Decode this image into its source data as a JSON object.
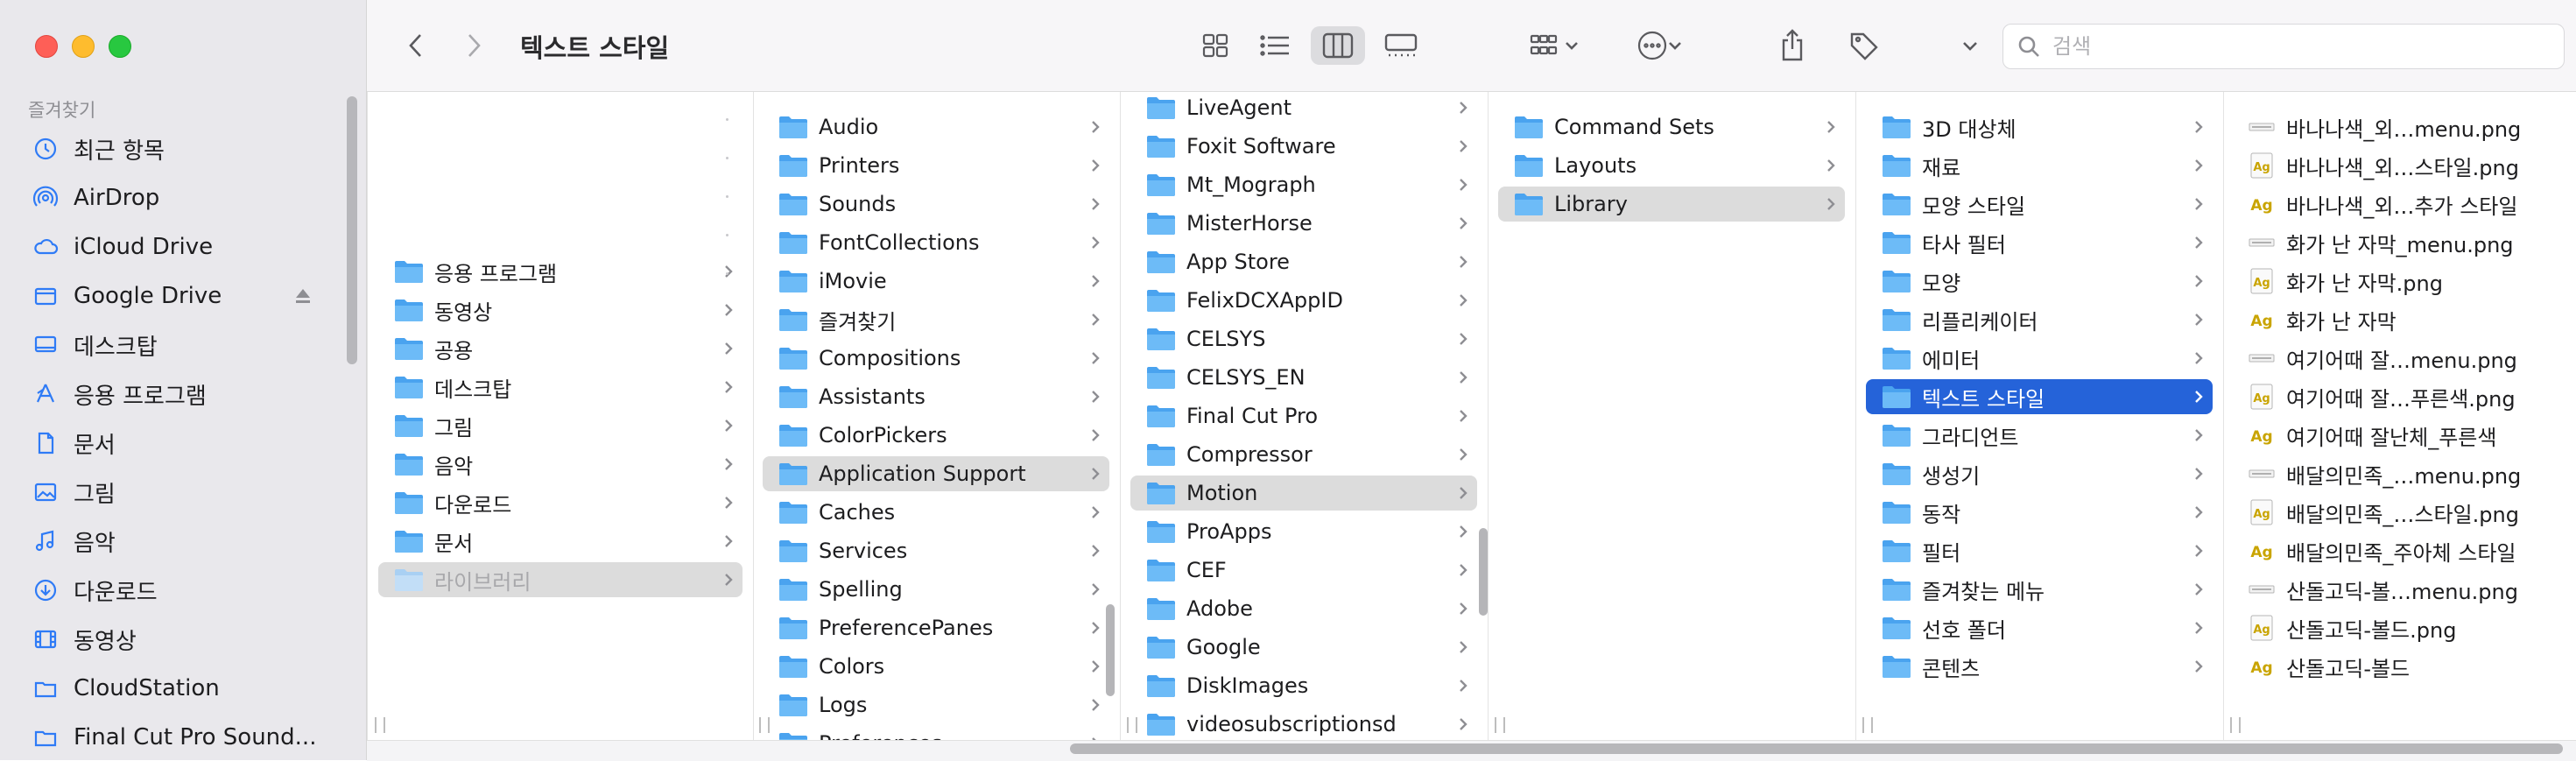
{
  "window": {
    "title": "텍스트 스타일",
    "traffic_lights": {
      "close": "#fe5f57",
      "minimize": "#febc2e",
      "zoom": "#28c840"
    }
  },
  "sidebar": {
    "heading": "즐겨찾기",
    "accent_color": "#2f7bf6",
    "items": [
      {
        "label": "최근 항목",
        "icon": "clock-icon"
      },
      {
        "label": "AirDrop",
        "icon": "airdrop-icon"
      },
      {
        "label": "iCloud Drive",
        "icon": "cloud-icon"
      },
      {
        "label": "Google Drive",
        "icon": "drive-folder-icon"
      },
      {
        "label": "데스크탑",
        "icon": "desktop-icon"
      },
      {
        "label": "응용 프로그램",
        "icon": "apps-icon"
      },
      {
        "label": "문서",
        "icon": "document-icon"
      },
      {
        "label": "그림",
        "icon": "photo-icon"
      },
      {
        "label": "음악",
        "icon": "music-icon"
      },
      {
        "label": "다운로드",
        "icon": "download-icon"
      },
      {
        "label": "동영상",
        "icon": "film-icon"
      },
      {
        "label": "CloudStation",
        "icon": "folder-icon"
      },
      {
        "label": "Final Cut Pro Sound...",
        "icon": "folder-icon"
      }
    ]
  },
  "toolbar": {
    "back_icon": "chevron-left-icon",
    "forward_icon": "chevron-right-icon",
    "view_modes": [
      "icon-view",
      "list-view",
      "column-view",
      "gallery-view"
    ],
    "active_view": "column-view",
    "search_placeholder": "검색"
  },
  "columns": [
    {
      "id": "home",
      "items": [
        {
          "name": "응용 프로그램",
          "icon": "folder"
        },
        {
          "name": "동영상",
          "icon": "folder"
        },
        {
          "name": "공용",
          "icon": "folder"
        },
        {
          "name": "데스크탑",
          "icon": "folder"
        },
        {
          "name": "그림",
          "icon": "folder"
        },
        {
          "name": "음악",
          "icon": "folder"
        },
        {
          "name": "다운로드",
          "icon": "folder"
        },
        {
          "name": "문서",
          "icon": "folder"
        },
        {
          "name": "라이브러리",
          "icon": "folder",
          "state": "selected-gray-dim"
        }
      ]
    },
    {
      "id": "library",
      "items": [
        {
          "name": "Audio"
        },
        {
          "name": "Printers"
        },
        {
          "name": "Sounds"
        },
        {
          "name": "FontCollections"
        },
        {
          "name": "iMovie"
        },
        {
          "name": "즐겨찾기"
        },
        {
          "name": "Compositions"
        },
        {
          "name": "Assistants"
        },
        {
          "name": "ColorPickers"
        },
        {
          "name": "Application Support",
          "state": "selected-gray"
        },
        {
          "name": "Caches"
        },
        {
          "name": "Services"
        },
        {
          "name": "Spelling"
        },
        {
          "name": "PreferencePanes"
        },
        {
          "name": "Colors"
        },
        {
          "name": "Logs"
        },
        {
          "name": "Preferences"
        }
      ]
    },
    {
      "id": "application-support",
      "items": [
        {
          "name": "LiveAgent"
        },
        {
          "name": "Foxit Software"
        },
        {
          "name": "Mt_Mograph"
        },
        {
          "name": "MisterHorse"
        },
        {
          "name": "App Store"
        },
        {
          "name": "FelixDCXAppID"
        },
        {
          "name": "CELSYS"
        },
        {
          "name": "CELSYS_EN"
        },
        {
          "name": "Final Cut Pro"
        },
        {
          "name": "Compressor"
        },
        {
          "name": "Motion",
          "state": "selected-gray"
        },
        {
          "name": "ProApps"
        },
        {
          "name": "CEF"
        },
        {
          "name": "Adobe"
        },
        {
          "name": "Google"
        },
        {
          "name": "DiskImages"
        },
        {
          "name": "videosubscriptionsd"
        }
      ]
    },
    {
      "id": "motion",
      "items": [
        {
          "name": "Command Sets"
        },
        {
          "name": "Layouts"
        },
        {
          "name": "Library",
          "state": "selected-gray"
        }
      ]
    },
    {
      "id": "motion-library",
      "items": [
        {
          "name": "3D 대상체"
        },
        {
          "name": "재료"
        },
        {
          "name": "모양 스타일"
        },
        {
          "name": "타사 필터"
        },
        {
          "name": "모양"
        },
        {
          "name": "리플리케이터"
        },
        {
          "name": "에미터"
        },
        {
          "name": "텍스트 스타일",
          "state": "selected-blue"
        },
        {
          "name": "그라디언트"
        },
        {
          "name": "생성기"
        },
        {
          "name": "동작"
        },
        {
          "name": "필터"
        },
        {
          "name": "즐겨찾는 메뉴"
        },
        {
          "name": "선호 폴더"
        },
        {
          "name": "콘텐츠"
        }
      ]
    },
    {
      "id": "text-styles",
      "items": [
        {
          "name": "바나나색_외…menu.png",
          "icon": "menu-thumb-icon"
        },
        {
          "name": "바나나색_외…스타일.png",
          "icon": "png-thumb-icon"
        },
        {
          "name": "바나나색_외…추가 스타일",
          "icon": "text-style-icon"
        },
        {
          "name": "화가 난 자막_menu.png",
          "icon": "menu-thumb-icon"
        },
        {
          "name": "화가 난 자막.png",
          "icon": "png-thumb-icon"
        },
        {
          "name": "화가 난 자막",
          "icon": "text-style-icon"
        },
        {
          "name": "여기어때 잘…menu.png",
          "icon": "menu-thumb-icon"
        },
        {
          "name": "여기어때 잘…푸른색.png",
          "icon": "png-thumb-icon"
        },
        {
          "name": "여기어때 잘난체_푸른색",
          "icon": "text-style-icon"
        },
        {
          "name": "배달의민족_…menu.png",
          "icon": "menu-thumb-icon"
        },
        {
          "name": "배달의민족_…스타일.png",
          "icon": "png-thumb-icon"
        },
        {
          "name": "배달의민족_주아체 스타일",
          "icon": "text-style-icon"
        },
        {
          "name": "산돌고딕-볼…menu.png",
          "icon": "menu-thumb-icon"
        },
        {
          "name": "산돌고딕-볼드.png",
          "icon": "png-thumb-icon"
        },
        {
          "name": "산돌고딕-볼드",
          "icon": "text-style-icon"
        }
      ]
    }
  ],
  "colors": {
    "selection_blue": "#2563d9",
    "selection_gray": "#dcdcdc",
    "folder_blue": "#5aaef3"
  }
}
